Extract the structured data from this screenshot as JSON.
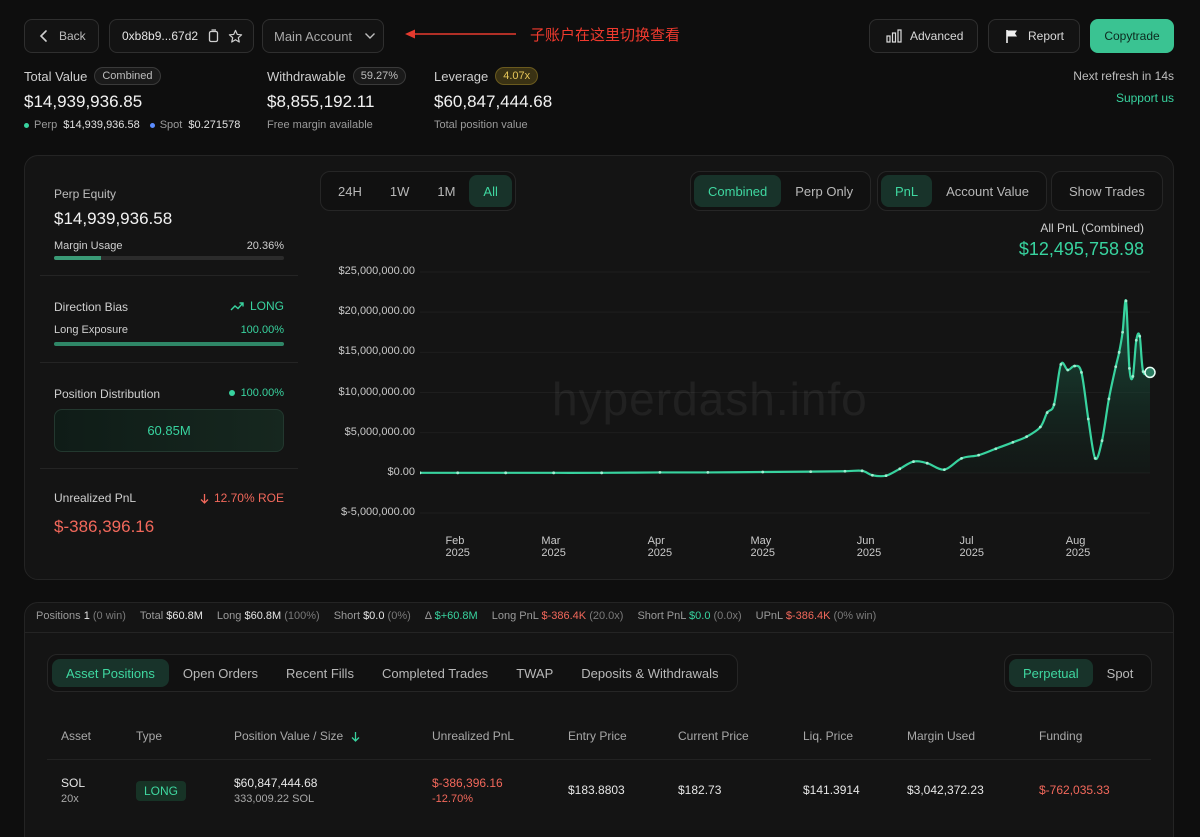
{
  "header": {
    "back_label": "Back",
    "address": "0xb8b9...67d2",
    "account_select": "Main Account",
    "annotation": "子账户在这里切换查看",
    "advanced_label": "Advanced",
    "report_label": "Report",
    "copytrade_label": "Copytrade",
    "refresh_text": "Next refresh in 14s",
    "support_label": "Support us"
  },
  "summary": {
    "total_value_label": "Total Value",
    "total_value_badge": "Combined",
    "total_value": "$14,939,936.85",
    "perp_label": "Perp",
    "perp_value": "$14,939,936.58",
    "spot_label": "Spot",
    "spot_value": "$0.271578",
    "withdrawable_label": "Withdrawable",
    "withdrawable_badge": "59.27%",
    "withdrawable": "$8,855,192.11",
    "withdrawable_sub": "Free margin available",
    "leverage_label": "Leverage",
    "leverage_badge": "4.07x",
    "leverage_value": "$60,847,444.68",
    "leverage_sub": "Total position value"
  },
  "left_panel": {
    "perp_equity_label": "Perp Equity",
    "perp_equity": "$14,939,936.58",
    "margin_usage_label": "Margin Usage",
    "margin_usage": "20.36%",
    "margin_usage_fraction": 0.2036,
    "direction_label": "Direction Bias",
    "direction_value": "LONG",
    "long_exposure_label": "Long Exposure",
    "long_exposure": "100.00%",
    "long_exposure_fraction": 1.0,
    "position_dist_label": "Position Distribution",
    "position_dist_pct": "100.00%",
    "position_dist_value": "60.85M",
    "unrealized_label": "Unrealized PnL",
    "unrealized_roe": "12.70% ROE",
    "unrealized_value": "$-386,396.16"
  },
  "chart_controls": {
    "ranges": [
      "24H",
      "1W",
      "1M",
      "All"
    ],
    "range_active": 3,
    "modes": [
      "Combined",
      "Perp Only"
    ],
    "mode_active": 0,
    "metrics": [
      "PnL",
      "Account Value"
    ],
    "metric_active": 0,
    "show_trades_label": "Show Trades",
    "pnl_title": "All PnL (Combined)",
    "pnl_value": "$12,495,758.98",
    "watermark": "hyperdash.info"
  },
  "chart_data": {
    "type": "area",
    "title": "All PnL (Combined)",
    "xlabel": "",
    "ylabel": "",
    "ylim": [
      -5000000,
      25000000
    ],
    "yticks": [
      25000000,
      20000000,
      15000000,
      10000000,
      5000000,
      0,
      -5000000
    ],
    "ytick_labels": [
      "$25,000,000.00",
      "$20,000,000.00",
      "$15,000,000.00",
      "$10,000,000.00",
      "$5,000,000.00",
      "$0.00",
      "$-5,000,000.00"
    ],
    "xticks": [
      "2025-02-01",
      "2025-03-01",
      "2025-04-01",
      "2025-05-01",
      "2025-06-01",
      "2025-07-01",
      "2025-08-01"
    ],
    "xtick_labels": [
      "Feb 2025",
      "Mar 2025",
      "Apr 2025",
      "May 2025",
      "Jun 2025",
      "Jul 2025",
      "Aug 2025"
    ],
    "xlim": [
      "2025-01-21",
      "2025-08-22"
    ],
    "colors": {
      "line": "#38d39f",
      "fill": "#1c5a45"
    },
    "series": [
      {
        "x": [
          "2025-01-21",
          "2025-02-01",
          "2025-02-15",
          "2025-03-01",
          "2025-03-15",
          "2025-04-01",
          "2025-04-15",
          "2025-05-01",
          "2025-05-15",
          "2025-05-25",
          "2025-05-30",
          "2025-06-02",
          "2025-06-06",
          "2025-06-10",
          "2025-06-14",
          "2025-06-18",
          "2025-06-23",
          "2025-06-28",
          "2025-07-03",
          "2025-07-08",
          "2025-07-13",
          "2025-07-17",
          "2025-07-21",
          "2025-07-23",
          "2025-07-25",
          "2025-07-27",
          "2025-07-29",
          "2025-07-31",
          "2025-08-02",
          "2025-08-04",
          "2025-08-06",
          "2025-08-08",
          "2025-08-10",
          "2025-08-12",
          "2025-08-13",
          "2025-08-14",
          "2025-08-15",
          "2025-08-16",
          "2025-08-17",
          "2025-08-18",
          "2025-08-19",
          "2025-08-20",
          "2025-08-22"
        ],
        "y": [
          0,
          0,
          0,
          0,
          0,
          50000,
          50000,
          100000,
          150000,
          200000,
          250000,
          -300000,
          -350000,
          500000,
          1400000,
          1200000,
          400000,
          1800000,
          2200000,
          3000000,
          3800000,
          4500000,
          5700000,
          7500000,
          8500000,
          13500000,
          12800000,
          13300000,
          12500000,
          6700000,
          1800000,
          4000000,
          9200000,
          13200000,
          15000000,
          17500000,
          21400000,
          13000000,
          12000000,
          16500000,
          17000000,
          12600000,
          12500000
        ]
      }
    ]
  },
  "stats_bar": {
    "positions_label": "Positions",
    "positions": "1",
    "positions_win": "(0 win)",
    "total_label": "Total",
    "total": "$60.8M",
    "long_label": "Long",
    "long": "$60.8M",
    "long_pct": "(100%)",
    "short_label": "Short",
    "short": "$0.0",
    "short_pct": "(0%)",
    "delta_label": "Δ",
    "delta": "$+60.8M",
    "long_pnl_label": "Long PnL",
    "long_pnl": "$-386.4K",
    "long_pnl_x": "(20.0x)",
    "short_pnl_label": "Short PnL",
    "short_pnl": "$0.0",
    "short_pnl_x": "(0.0x)",
    "upnl_label": "UPnL",
    "upnl": "$-386.4K",
    "upnl_win": "(0% win)"
  },
  "tabs": {
    "items": [
      "Asset Positions",
      "Open Orders",
      "Recent Fills",
      "Completed Trades",
      "TWAP",
      "Deposits & Withdrawals"
    ],
    "active": 0,
    "market": [
      "Perpetual",
      "Spot"
    ],
    "market_active": 0
  },
  "table": {
    "headers": [
      "Asset",
      "Type",
      "Position Value / Size",
      "Unrealized PnL",
      "Entry Price",
      "Current Price",
      "Liq. Price",
      "Margin Used",
      "Funding"
    ],
    "row": {
      "asset": "SOL",
      "leverage": "20x",
      "type": "LONG",
      "value": "$60,847,444.68",
      "size": "333,009.22 SOL",
      "upnl": "$-386,396.16",
      "upnl_pct": "-12.70%",
      "entry": "$183.8803",
      "current": "$182.73",
      "liq": "$141.3914",
      "margin": "$3,042,372.23",
      "funding": "$-762,035.33"
    }
  }
}
